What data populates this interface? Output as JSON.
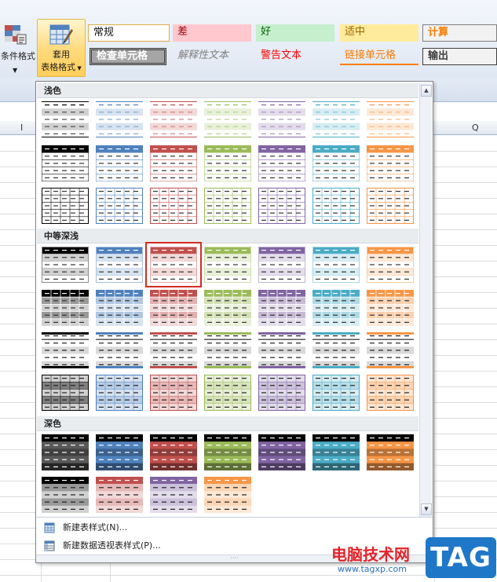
{
  "ribbon": {
    "cond_format_label": "条件格式",
    "table_format_label_1": "套用",
    "table_format_label_2": "表格格式",
    "cell_styles": {
      "normal": "常规",
      "bad": "差",
      "good": "好",
      "neutral": "适中",
      "calc": "计算",
      "check": "检查单元格",
      "explain": "解释性文本",
      "warn": "警告文本",
      "link": "链接单元格",
      "output": "输出"
    }
  },
  "sheet": {
    "col_i": "I",
    "col_q": "Q"
  },
  "gallery": {
    "section_light": "浅色",
    "section_medium": "中等深浅",
    "section_dark": "深色",
    "colors": [
      "#000000",
      "#4f81bd",
      "#c0504d",
      "#9bbb59",
      "#8064a2",
      "#4bacc6",
      "#f79646"
    ],
    "selected": "中等深浅 1",
    "menu": {
      "new_table_style": "新建表样式(N)...",
      "new_pivot_style": "新建数据透视表样式(P)..."
    }
  },
  "watermark": {
    "site": "电脑技术网",
    "url": "www.tagxp.com",
    "tag": "TAG"
  }
}
